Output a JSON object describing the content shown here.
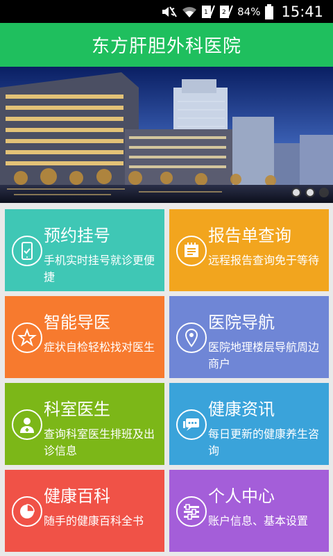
{
  "status_bar": {
    "battery": "84%",
    "time": "15:41",
    "icons": [
      "mute-icon",
      "wifi-icon",
      "sim1-icon",
      "sim2-icon",
      "battery-icon"
    ]
  },
  "header": {
    "title": "东方肝胆外科医院"
  },
  "banner": {
    "slides": 3,
    "active_slide": 2
  },
  "tiles": [
    {
      "title": "预约挂号",
      "desc": "手机实时挂号就诊更便捷",
      "color": "#3fc7b5",
      "icon": "phone-check-icon"
    },
    {
      "title": "报告单查询",
      "desc": "远程报告查询免于等待",
      "color": "#f2a51e",
      "icon": "report-icon"
    },
    {
      "title": "智能导医",
      "desc": "症状自检轻松找对医生",
      "color": "#f77a2e",
      "icon": "star-guide-icon"
    },
    {
      "title": "医院导航",
      "desc": "医院地理楼层导航周边商户",
      "color": "#6f86d6",
      "icon": "location-pin-icon"
    },
    {
      "title": "科室医生",
      "desc": "查询科室医生排班及出诊信息",
      "color": "#7cb718",
      "icon": "doctor-icon"
    },
    {
      "title": "健康资讯",
      "desc": "每日更新的健康养生咨询",
      "color": "#3aa3da",
      "icon": "chat-icon"
    },
    {
      "title": "健康百科",
      "desc": "随手的健康百科全书",
      "color": "#f05247",
      "icon": "pie-chart-icon"
    },
    {
      "title": "个人中心",
      "desc": "账户信息、基本设置",
      "color": "#a45ed9",
      "icon": "list-settings-icon"
    }
  ]
}
